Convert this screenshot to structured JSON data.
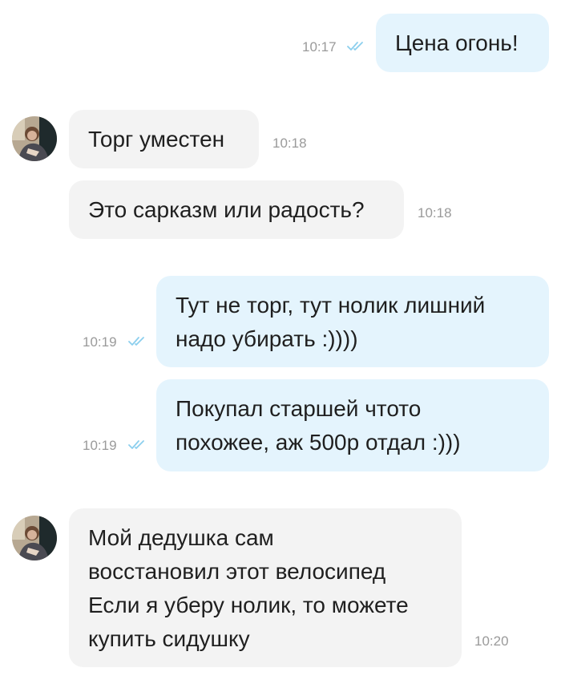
{
  "messages": [
    {
      "direction": "outgoing",
      "text": "Цена огонь!",
      "time": "10:17",
      "status_icon": "double-check-icon"
    },
    {
      "direction": "incoming",
      "text": "Торг уместен",
      "time": "10:18",
      "avatar": "user-avatar"
    },
    {
      "direction": "incoming",
      "text": "Это сарказм или радость?",
      "time": "10:18"
    },
    {
      "direction": "outgoing",
      "text": "Тут не торг, тут нолик лишний\nнадо убирать :))))",
      "time": "10:19",
      "status_icon": "double-check-icon"
    },
    {
      "direction": "outgoing",
      "text": "Покупал старшей чтото\nпохожее, аж 500р отдал :)))",
      "time": "10:19",
      "status_icon": "double-check-icon"
    },
    {
      "direction": "incoming",
      "text": "Мой дедушка сам\nвосстановил этот велосипед\nЕсли я уберу нолик, то можете\nкупить сидушку",
      "time": "10:20",
      "avatar": "user-avatar"
    }
  ],
  "colors": {
    "outgoing_bubble": "#e4f4fd",
    "incoming_bubble": "#f3f3f3",
    "read_ticks": "#8ccfee",
    "timestamp": "#9a9a9a",
    "message_text": "#1f1f1f"
  }
}
